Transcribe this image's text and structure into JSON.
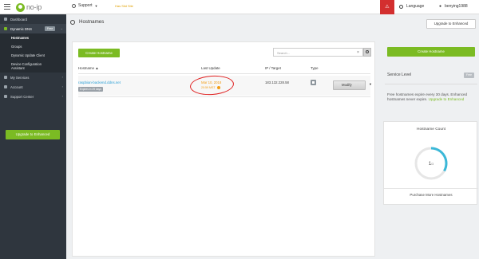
{
  "topbar": {
    "logo_text": "no-ip",
    "support_label": "Support",
    "domain_alert": "Has Slid Site",
    "language_label": "Language",
    "username": "benying1988"
  },
  "sidebar": {
    "items": [
      {
        "label": "Dashboard"
      },
      {
        "label": "Dynamic DNS",
        "badge": "Free"
      },
      {
        "label": "My Services"
      },
      {
        "label": "Account"
      },
      {
        "label": "Support Center"
      }
    ],
    "subitems": [
      "Hostnames",
      "Groups",
      "Dynamic Update Client",
      "Device Configuration",
      "Assistant"
    ],
    "upgrade_label": "Upgrade to Enhanced"
  },
  "header": {
    "title": "Hostnames",
    "upgrade_label": "Upgrade to Enhanced"
  },
  "main": {
    "create_label": "Create Hostname",
    "search_placeholder": "Search...",
    "columns": [
      "Hostname ▲",
      "Last Update",
      "IP / Target",
      "Type"
    ],
    "row": {
      "hostname": "raspbian-backend.ddns.net",
      "expires": "Expires in 29 days",
      "last_update_date": "Mar 10, 2018",
      "last_update_time": "20:59 MST",
      "ip": "183.132.228.58",
      "action_label": "Modify"
    }
  },
  "right": {
    "create_label": "Create Hostname",
    "service_level_label": "Service Level",
    "service_level_badge": "Free",
    "desc_main": "Free hostnames expire every 30 days. Enhanced hostnames never expire.",
    "desc_link": "Upgrade to Enhanced",
    "count_title": "Hostname Count",
    "count_used": "1",
    "count_total": "/3",
    "count_fraction": 0.3333,
    "purchase_label": "Purchase More Hostnames"
  },
  "colors": {
    "accent_green": "#7bbb23",
    "alert_red": "#d32f2f",
    "link_blue": "#2a9fd6",
    "warning_orange": "#f39c12",
    "sidebar_bg": "#2f363e"
  }
}
